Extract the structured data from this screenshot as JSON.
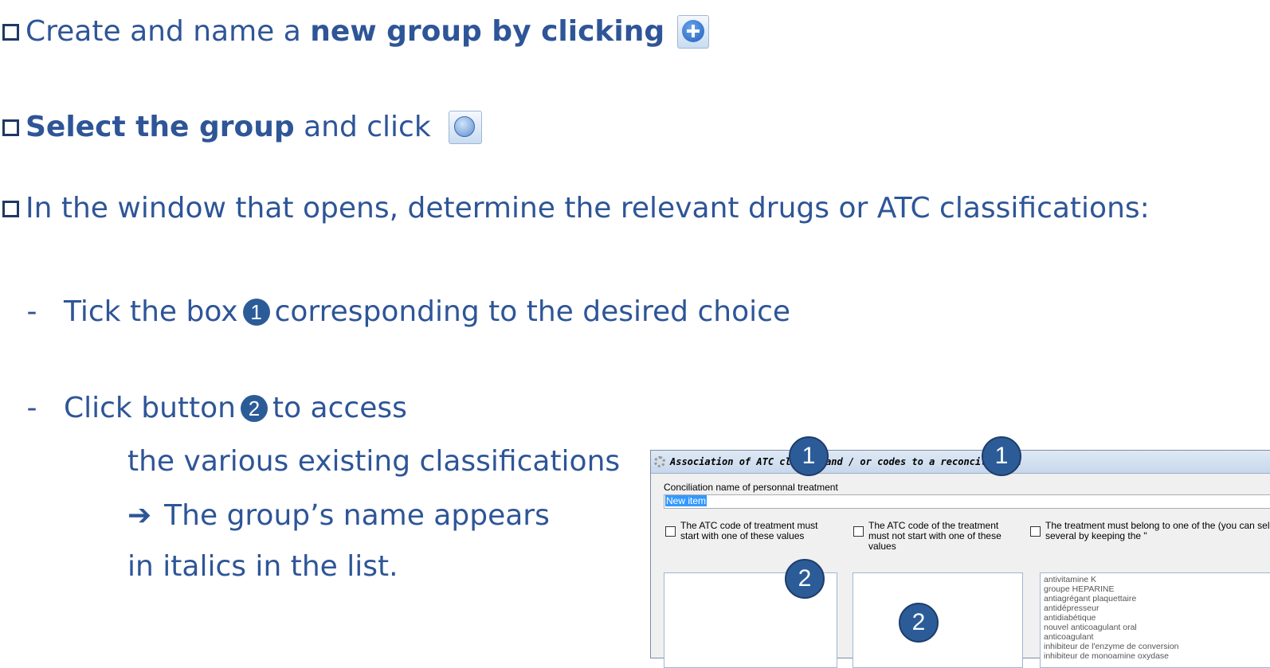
{
  "steps": [
    {
      "pre": "Create and name a ",
      "bold": "new group by clicking",
      "post": ""
    },
    {
      "pre": "",
      "bold": "Select the group",
      "post": " and click"
    },
    {
      "pre": "In the window that opens, determine the relevant drugs or ATC classifications:",
      "bold": "",
      "post": ""
    }
  ],
  "sub1": {
    "dash": "-",
    "pre": "Tick the box",
    "badge": "1",
    "post": "corresponding to the desired choice"
  },
  "sub2": {
    "dash": "-",
    "pre": "Click button",
    "badge": "2",
    "post": "to access"
  },
  "sub2_lines": [
    "the various existing classifications",
    "The group’s name appears",
    "in italics in the list."
  ],
  "arrow": "➔",
  "icons": {
    "add": "add-circle-icon",
    "globe": "globe-settings-icon",
    "title": "gear-icon"
  },
  "dialog": {
    "title": "Association of ATC classes and / or codes to a reconciliation",
    "name_label": "Conciliation name of personnal treatment",
    "name_value": "New item",
    "opt1": "The ATC code of treatment must start with one of these values",
    "opt2": "The ATC code of the treatment must not start with one of these values",
    "opt3": "The treatment must belong to one of the (you can select several by keeping the \"",
    "list": [
      "antivitamine K",
      "groupe HEPARINE",
      "antiagrégant plaquettaire",
      "antidépresseur",
      "antidiabétique",
      "nouvel anticoagulant oral",
      "anticoagulant",
      "inhibiteur de l'enzyme de conversion",
      "inhibiteur de monoamine oxydase"
    ]
  },
  "badges": {
    "one": "1",
    "two": "2"
  },
  "colors": {
    "text": "#2e5597",
    "badge": "#2c5c98"
  }
}
